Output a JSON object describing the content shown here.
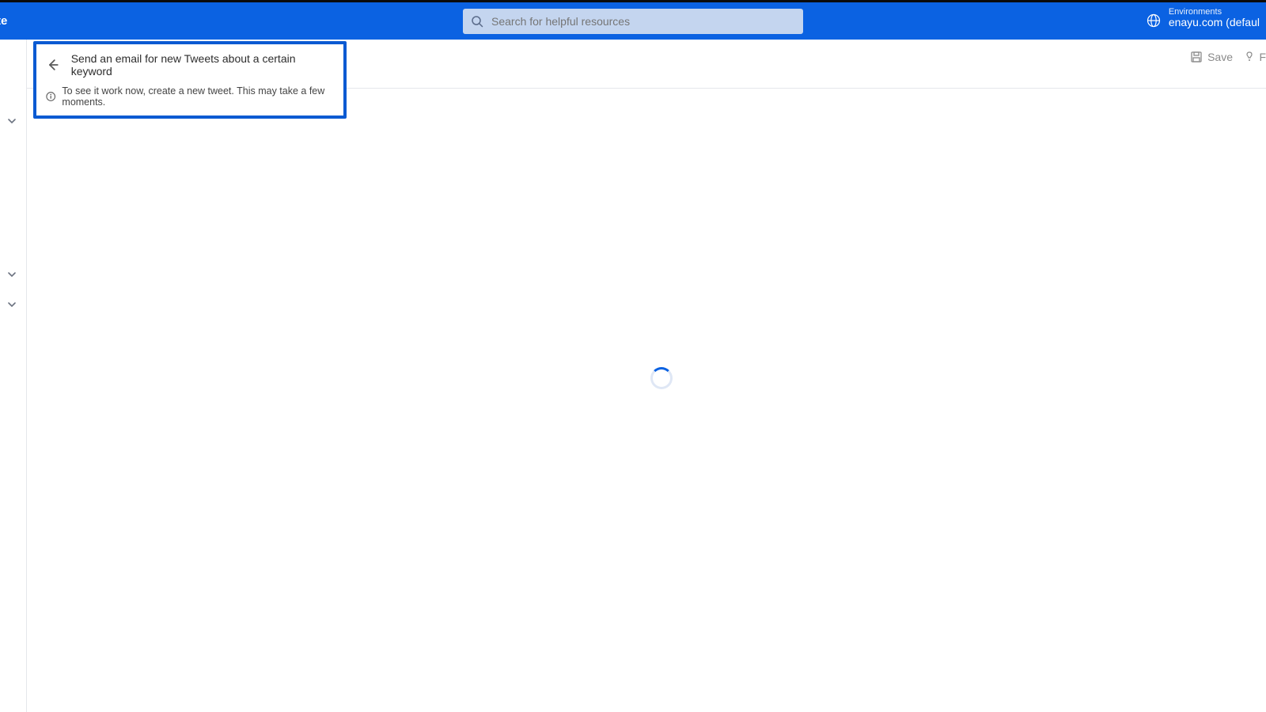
{
  "header": {
    "brand_fragment": "te",
    "search_placeholder": "Search for helpful resources",
    "environments_label": "Environments",
    "environment_name": "enayu.com (defaul"
  },
  "subheader": {
    "save_label": "Save",
    "flow_fragment": "F"
  },
  "callout": {
    "title": "Send an email for new Tweets about a certain keyword",
    "info": "To see it work now, create a new tweet. This may take a few moments."
  }
}
